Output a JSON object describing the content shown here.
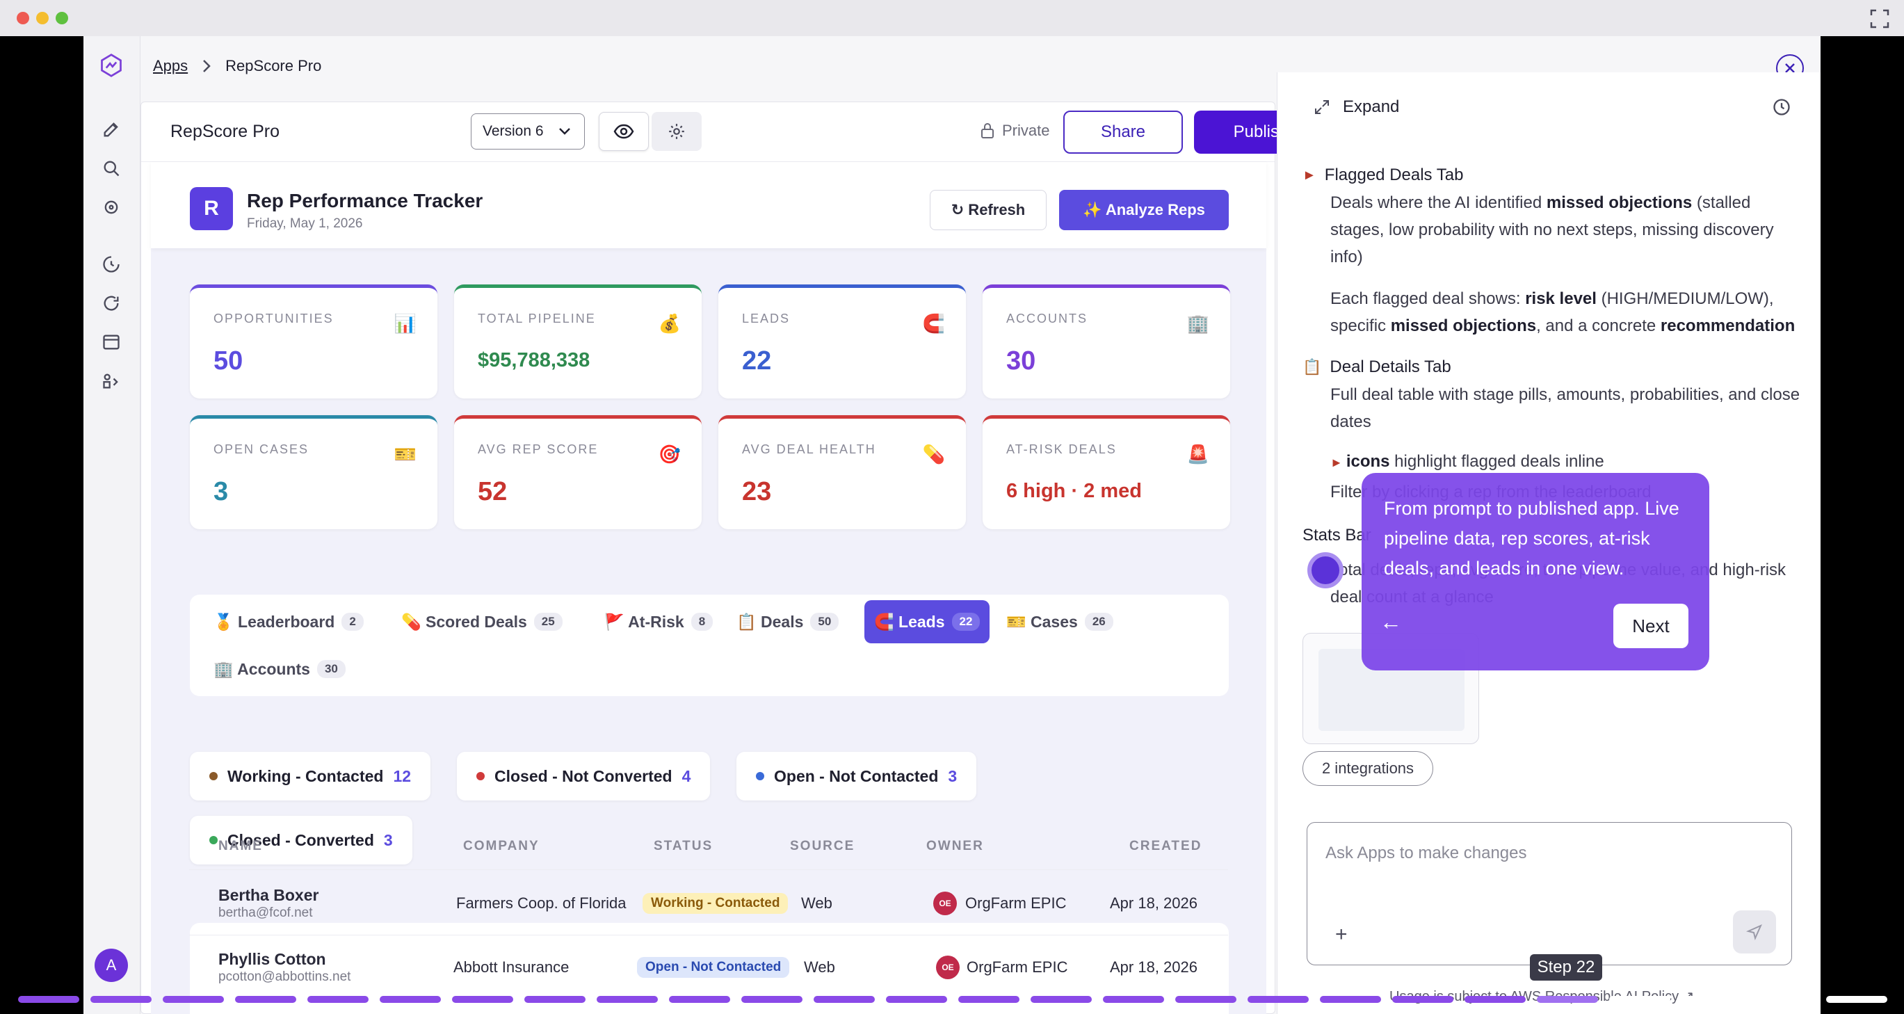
{
  "breadcrumb": {
    "root": "Apps",
    "current": "RepScore Pro"
  },
  "appbar": {
    "title": "RepScore Pro",
    "version": "Version 6",
    "privacy": "Private",
    "share_label": "Share",
    "publish_label": "Publish"
  },
  "tracker": {
    "badge": "R",
    "title": "Rep Performance Tracker",
    "date": "Friday, May 1, 2026",
    "refresh_label": "↻ Refresh",
    "analyze_label": "✨ Analyze Reps"
  },
  "stats": [
    {
      "label": "OPPORTUNITIES",
      "value": "50",
      "icon": "📊",
      "color": "#5b4cdf"
    },
    {
      "label": "TOTAL PIPELINE",
      "value": "$95,788,338",
      "icon": "💰",
      "color": "#2f8a4f"
    },
    {
      "label": "LEADS",
      "value": "22",
      "icon": "🧲",
      "color": "#3a5fd0"
    },
    {
      "label": "ACCOUNTS",
      "value": "30",
      "icon": "🏢",
      "color": "#7b3fd8"
    },
    {
      "label": "OPEN CASES",
      "value": "3",
      "icon": "🎫",
      "color": "#2a8aa8"
    },
    {
      "label": "AVG REP SCORE",
      "value": "52",
      "icon": "🎯",
      "color": "#c8342e"
    },
    {
      "label": "AVG DEAL HEALTH",
      "value": "23",
      "icon": "💊",
      "color": "#c8342e"
    },
    {
      "label": "AT-RISK DEALS",
      "value": "6 high · 2 med",
      "icon": "🚨",
      "color": "#c8342e"
    }
  ],
  "tabs": [
    {
      "label": "🏅 Leaderboard",
      "count": "2"
    },
    {
      "label": "💊 Scored Deals",
      "count": "25"
    },
    {
      "label": "🚩 At-Risk",
      "count": "8"
    },
    {
      "label": "📋 Deals",
      "count": "50"
    },
    {
      "label": "🧲 Leads",
      "count": "22"
    },
    {
      "label": "🎫 Cases",
      "count": "26"
    },
    {
      "label": "🏢 Accounts",
      "count": "30"
    }
  ],
  "status_pills": [
    {
      "label": "Working - Contacted",
      "count": "12",
      "color": "#8a5a2a"
    },
    {
      "label": "Closed - Not Converted",
      "count": "4",
      "color": "#d03a3a"
    },
    {
      "label": "Open - Not Contacted",
      "count": "3",
      "color": "#3a6ad8"
    },
    {
      "label": "Closed - Converted",
      "count": "3",
      "color": "#3aa85a"
    }
  ],
  "table": {
    "headers": [
      "NAME",
      "COMPANY",
      "STATUS",
      "SOURCE",
      "OWNER",
      "CREATED"
    ],
    "rows": [
      {
        "name": "Bertha Boxer",
        "email": "bertha@fcof.net",
        "company": "Farmers Coop. of Florida",
        "status": "Working - Contacted",
        "source": "Web",
        "owner_initials": "OE",
        "owner": "OrgFarm EPIC",
        "created": "Apr 18, 2026"
      },
      {
        "name": "Phyllis Cotton",
        "email": "pcotton@abbottins.net",
        "company": "Abbott Insurance",
        "status": "Open - Not Contacted",
        "source": "Web",
        "owner_initials": "OE",
        "owner": "OrgFarm EPIC",
        "created": "Apr 18, 2026"
      }
    ]
  },
  "panel": {
    "expand_label": "Expand",
    "flagged_head": "Flagged Deals Tab",
    "flagged_p1_a": "Deals where the AI identified ",
    "flagged_p1_b": "missed objections",
    "flagged_p1_c": " (stalled stages, low probability with no next steps, missing discovery info)",
    "flagged_p2_a": "Each flagged deal shows: ",
    "flagged_p2_b": "risk level",
    "flagged_p2_c": " (HIGH/MEDIUM/LOW), specific ",
    "flagged_p2_d": "missed objections",
    "flagged_p2_e": ", and a concrete ",
    "flagged_p2_f": "recommendation",
    "details_head": "Deal Details Tab",
    "details_p1": "Full deal table with stage pills, amounts, probabilities, and close dates",
    "details_p2_b": "icons",
    "details_p2_c": " highlight flagged deals inline",
    "details_p3": "Filter by clicking a rep from the leaderboard",
    "stats_head": "Stats Bar",
    "stats_p": "Total deals, reps, avg score, total pipeline value, and high-risk deal count at a glance",
    "integrations": "2 integrations",
    "chat_placeholder": "Ask Apps to make changes",
    "usage": "Usage is subject to AWS Responsible AI Policy ↗"
  },
  "tour": {
    "text": "From prompt to published app. Live pipeline data, rep scores, at-risk deals, and leads in one view.",
    "back": "←",
    "next": "Next",
    "step": "Step 22"
  },
  "colors": {
    "accent": "#5b4cdf",
    "publish": "#4b14d4",
    "tour": "#7c45e8"
  }
}
